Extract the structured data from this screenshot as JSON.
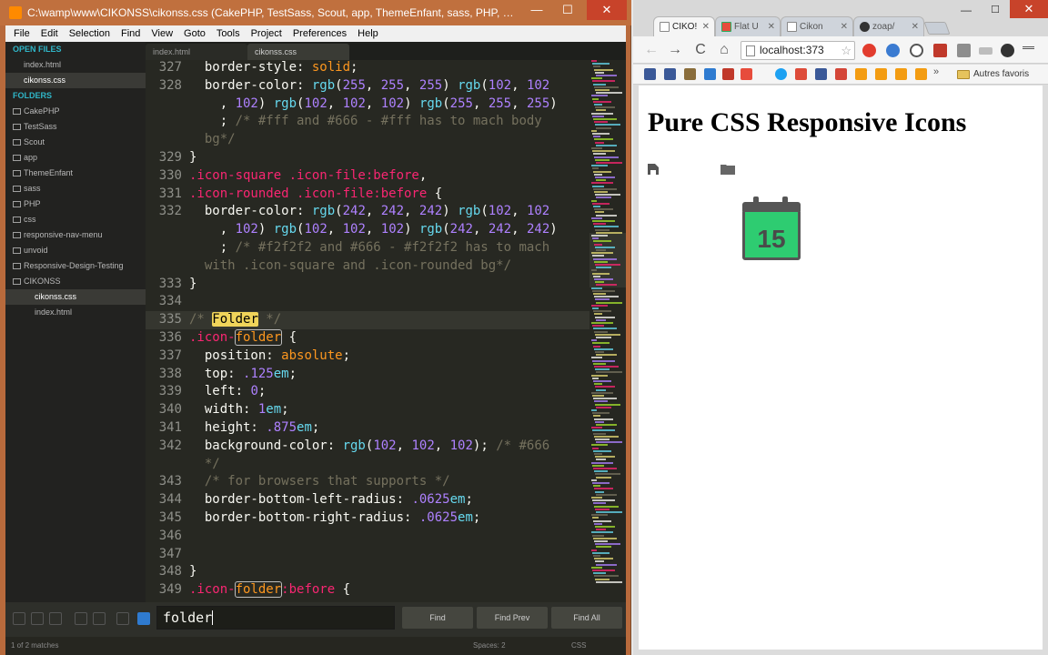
{
  "sublime": {
    "title": "C:\\wamp\\www\\CIKONSS\\cikonss.css (CakePHP, TestSass, Scout, app, ThemeEnfant, sass, PHP, cs...",
    "window_buttons": {
      "minimize": "—",
      "maximize": "☐",
      "close": "✕"
    },
    "menu": [
      "File",
      "Edit",
      "Selection",
      "Find",
      "View",
      "Goto",
      "Tools",
      "Project",
      "Preferences",
      "Help"
    ],
    "sidebar": {
      "open_files_header": "OPEN FILES",
      "open_files": [
        "index.html",
        "cikonss.css"
      ],
      "folders_header": "FOLDERS",
      "folders": [
        "CakePHP",
        "TestSass",
        "Scout",
        "app",
        "ThemeEnfant",
        "sass",
        "PHP",
        "css",
        "responsive-nav-menu",
        "unvoid",
        "Responsive-Design-Testing",
        "CIKONSS"
      ],
      "subfiles": [
        "cikonss.css",
        "index.html"
      ]
    },
    "tabs": [
      "index.html",
      "cikonss.css"
    ],
    "find": {
      "query": "folder",
      "find_label": "Find",
      "find_prev_label": "Find Prev",
      "find_all_label": "Find All"
    },
    "status": {
      "matches": "1 of 2 matches",
      "spaces": "Spaces: 2",
      "syntax": "CSS"
    },
    "accent_color": "#f0d45a"
  },
  "chrome": {
    "tabs": [
      "CIKO!",
      "Flat U",
      "Cikon",
      "zoap/"
    ],
    "window_buttons": {
      "minimize": "—",
      "maximize": "☐",
      "close": "✕"
    },
    "nav": {
      "back": "←",
      "forward": "→",
      "reload": "C",
      "home": "⌂"
    },
    "url": "localhost:373",
    "bookmarks_more": "»",
    "bookmarks_other": "Autres favoris",
    "page": {
      "heading": "Pure CSS Responsive Icons",
      "calendar_day": "15",
      "calendar_color": "#2ecc71"
    }
  }
}
